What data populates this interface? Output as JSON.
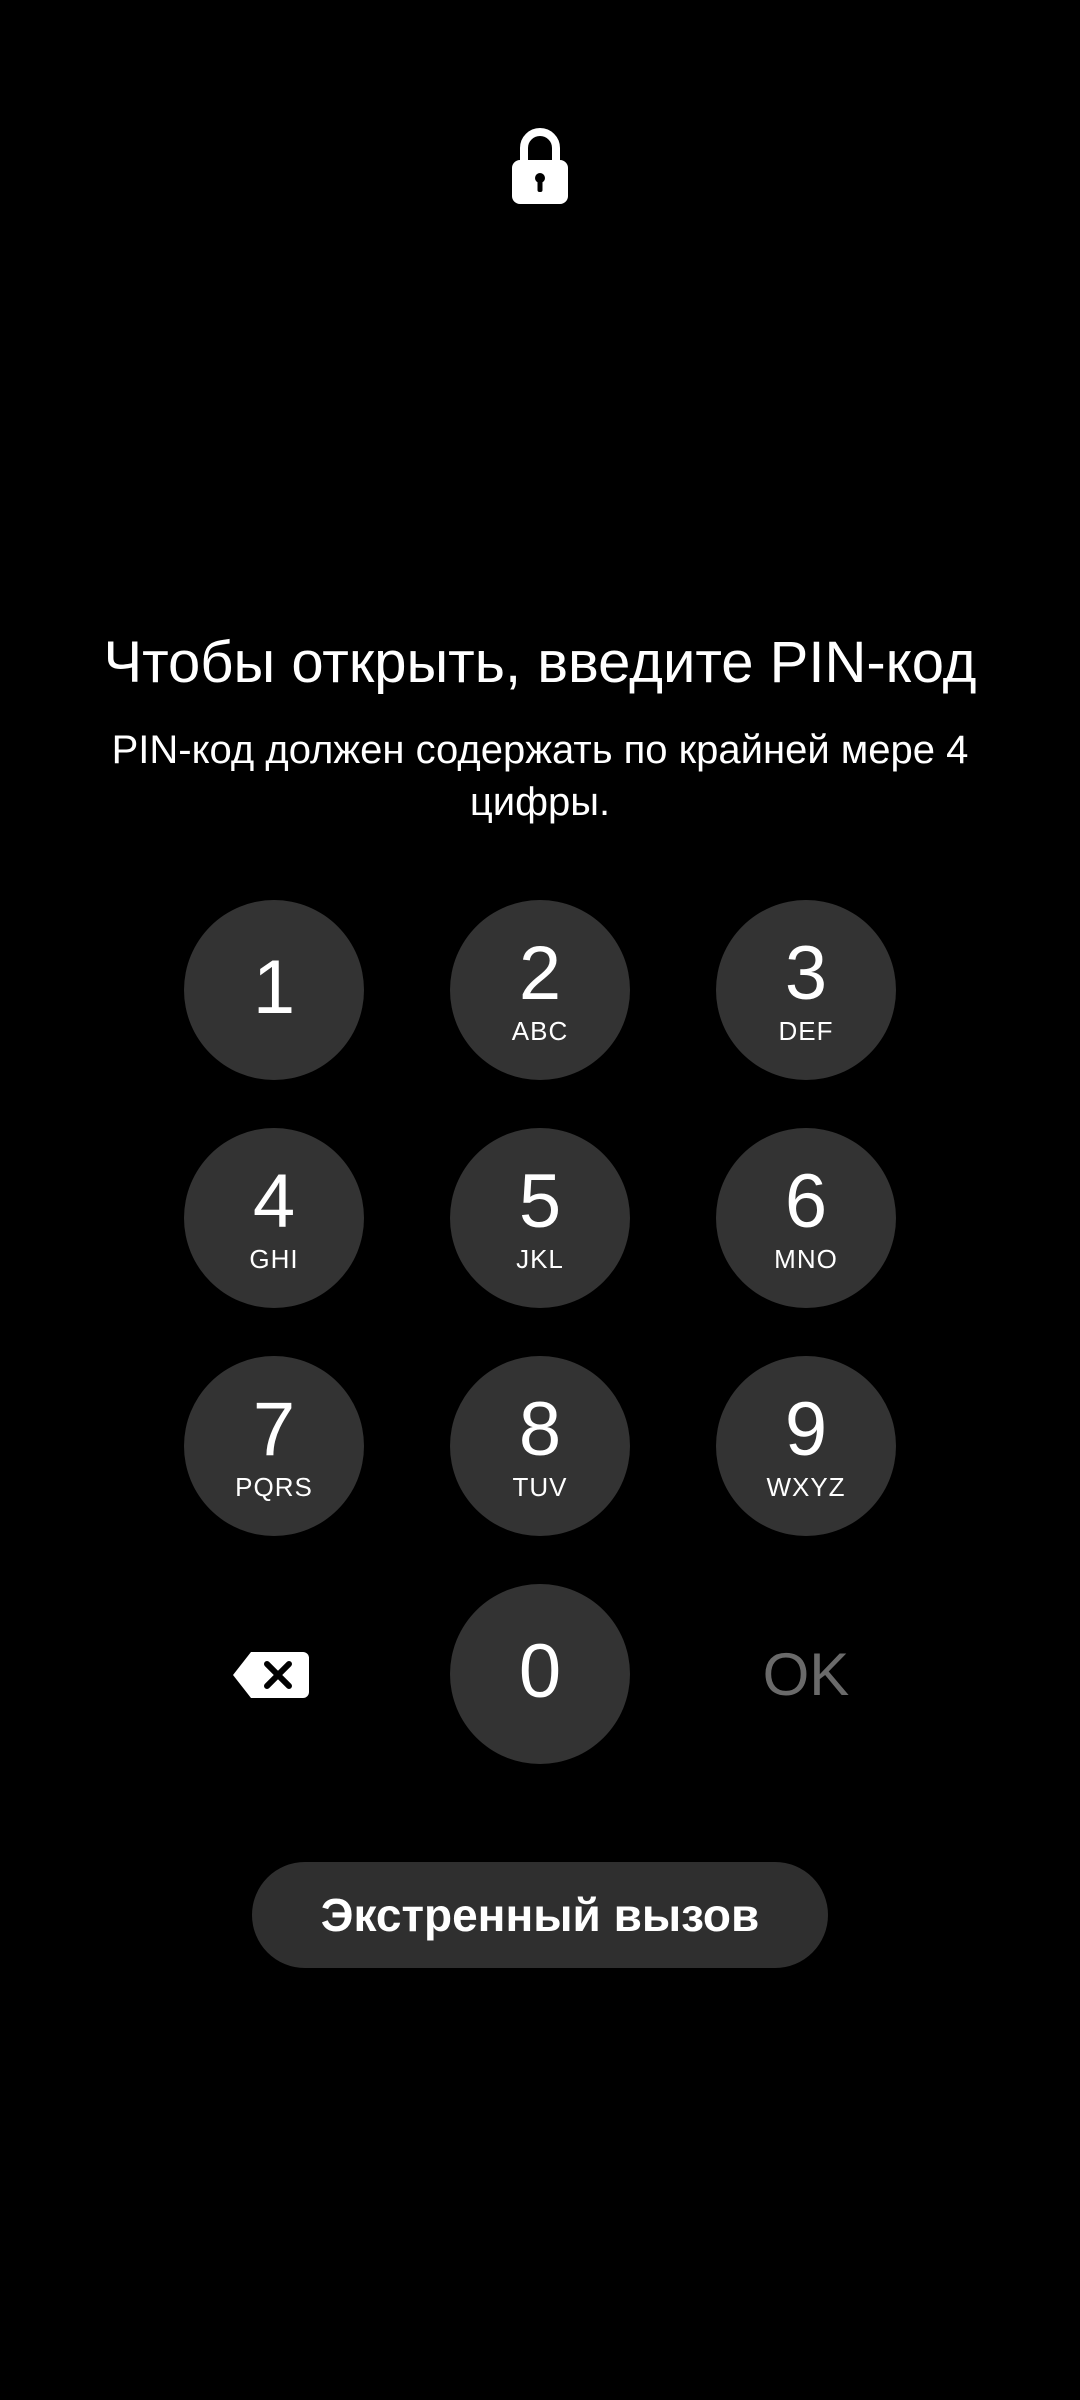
{
  "lockscreen": {
    "lock_icon": "lock-icon",
    "title": "Чтобы открыть, введите PIN-код",
    "hint": "PIN-код должен содержать по крайней мере 4 цифры."
  },
  "keypad": {
    "keys": [
      {
        "digit": "1",
        "letters": ""
      },
      {
        "digit": "2",
        "letters": "ABC"
      },
      {
        "digit": "3",
        "letters": "DEF"
      },
      {
        "digit": "4",
        "letters": "GHI"
      },
      {
        "digit": "5",
        "letters": "JKL"
      },
      {
        "digit": "6",
        "letters": "MNO"
      },
      {
        "digit": "7",
        "letters": "PQRS"
      },
      {
        "digit": "8",
        "letters": "TUV"
      },
      {
        "digit": "9",
        "letters": "WXYZ"
      },
      {
        "digit": "0",
        "letters": ""
      }
    ],
    "backspace_icon": "backspace-icon",
    "ok_label": "OK"
  },
  "emergency_call_label": "Экстренный вызов",
  "colors": {
    "background": "#000000",
    "key_fill": "#333333",
    "ok_disabled": "#6a6a6a"
  }
}
